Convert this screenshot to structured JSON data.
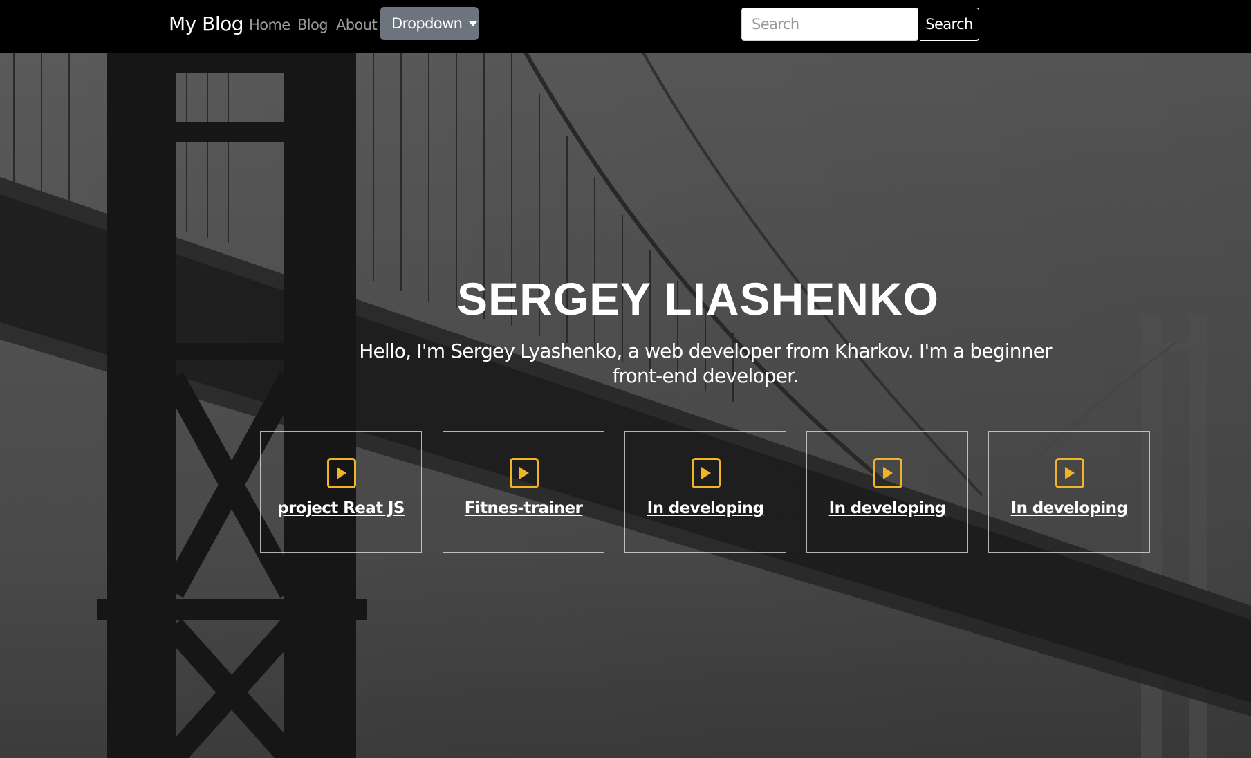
{
  "navbar": {
    "brand": "My Blog",
    "links": [
      "Home",
      "Blog",
      "About"
    ],
    "dropdown_label": "Dropdown",
    "search_placeholder": "Search",
    "search_button": "Search"
  },
  "hero": {
    "title": "SERGEY LIASHENKO",
    "subtitle": "Hello, I'm Sergey Lyashenko, a web developer from Kharkov. I'm a beginner front-end developer."
  },
  "projects": [
    {
      "label": "project Reat JS",
      "icon": "play-file-icon"
    },
    {
      "label": "Fitnes-trainer",
      "icon": "play-file-icon"
    },
    {
      "label": "In developing",
      "icon": "play-file-icon"
    },
    {
      "label": "In developing",
      "icon": "play-file-icon"
    },
    {
      "label": "In developing",
      "icon": "play-file-icon"
    }
  ],
  "colors": {
    "navbar_bg": "#000000",
    "dropdown_bg": "#6c757d",
    "icon_accent": "#f0b429",
    "hero_overlay": "#4f4f4f"
  }
}
